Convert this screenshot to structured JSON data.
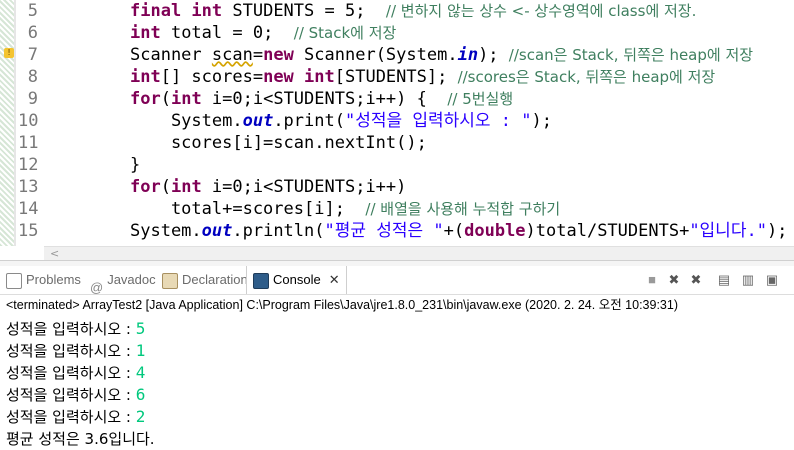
{
  "editor": {
    "lines": [
      {
        "n": "5",
        "parts": [
          [
            "kw",
            "final "
          ],
          [
            "kw",
            "int "
          ],
          [
            "",
            "STUDENTS = 5;  "
          ],
          [
            "cm",
            "// 변하지 않는 상수 <- 상수영역에 class에 저장."
          ]
        ]
      },
      {
        "n": "6",
        "parts": [
          [
            "kw",
            "int "
          ],
          [
            "",
            "total = 0;  "
          ],
          [
            "cm",
            "// Stack에 저장"
          ]
        ]
      },
      {
        "n": "7",
        "parts": [
          [
            "",
            "Scanner "
          ],
          [
            "warn",
            "scan"
          ],
          [
            "",
            "="
          ],
          [
            "kw",
            "new "
          ],
          [
            "",
            "Scanner(System."
          ],
          [
            "fld",
            "in"
          ],
          [
            "",
            "); "
          ],
          [
            "cm",
            "//scan은 Stack, 뒤쪽은 heap에 저장"
          ]
        ]
      },
      {
        "n": "8",
        "parts": [
          [
            "kw",
            "int"
          ],
          [
            "",
            "[] scores="
          ],
          [
            "kw",
            "new "
          ],
          [
            "kw",
            "int"
          ],
          [
            "",
            "[STUDENTS]; "
          ],
          [
            "cm",
            "//scores은 Stack, 뒤쪽은 heap에 저장"
          ]
        ]
      },
      {
        "n": "9",
        "parts": [
          [
            "kw",
            "for"
          ],
          [
            "",
            "("
          ],
          [
            "kw",
            "int "
          ],
          [
            "",
            "i=0;i<STUDENTS;i++) {  "
          ],
          [
            "cm",
            "// 5번실행"
          ]
        ]
      },
      {
        "n": "10",
        "parts": [
          [
            "",
            "    System."
          ],
          [
            "fld",
            "out"
          ],
          [
            "",
            ".print("
          ],
          [
            "st",
            "\"성적을 입력하시오 : \""
          ],
          [
            "",
            ");"
          ]
        ]
      },
      {
        "n": "11",
        "parts": [
          [
            "",
            "    scores[i]=scan.nextInt();"
          ]
        ]
      },
      {
        "n": "12",
        "parts": [
          [
            "",
            "}"
          ]
        ]
      },
      {
        "n": "13",
        "parts": [
          [
            "kw",
            "for"
          ],
          [
            "",
            "("
          ],
          [
            "kw",
            "int "
          ],
          [
            "",
            "i=0;i<STUDENTS;i++)"
          ]
        ]
      },
      {
        "n": "14",
        "parts": [
          [
            "",
            "    total+=scores[i];  "
          ],
          [
            "cm",
            "// 배열을 사용해 누적합 구하기"
          ]
        ]
      },
      {
        "n": "15",
        "parts": [
          [
            "",
            "System."
          ],
          [
            "fld",
            "out"
          ],
          [
            "",
            ".println("
          ],
          [
            "st",
            "\"평균 성적은 \""
          ],
          [
            "",
            "+("
          ],
          [
            "kw",
            "double"
          ],
          [
            "",
            ")total/STUDENTS+"
          ],
          [
            "st",
            "\"입니다.\""
          ],
          [
            "",
            ");"
          ]
        ]
      }
    ],
    "scroll_left_glyph": "<"
  },
  "tabs": {
    "problems": "Problems",
    "javadoc": "Javadoc",
    "javadoc_symbol": "@",
    "declaration": "Declaration",
    "console": "Console",
    "close": "✕"
  },
  "toolbar": {
    "terminate": "■",
    "remove": "✖",
    "remove_all": "✖",
    "clear": "▤",
    "scroll_lock": "▥",
    "pin": "▣"
  },
  "console": {
    "status": "<terminated> ArrayTest2 [Java Application] C:\\Program Files\\Java\\jre1.8.0_231\\bin\\javaw.exe (2020. 2. 24. 오전 10:39:31)",
    "prompt": "성적을 입력하시오 : ",
    "inputs": [
      "5",
      "1",
      "4",
      "6",
      "2"
    ],
    "result": "평균 성적은 3.6입니다."
  }
}
